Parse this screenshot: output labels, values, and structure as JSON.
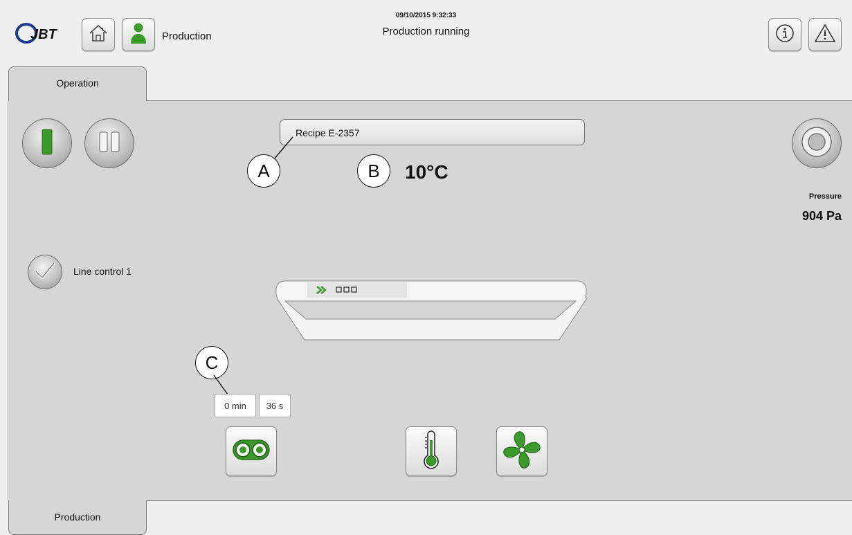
{
  "header": {
    "logo_text": "JBT",
    "user_label": "Production",
    "datetime": "09/10/2015 9:32:33",
    "status": "Production running"
  },
  "tabs": {
    "top": "Operation",
    "bottom": "Production"
  },
  "recipe": {
    "label": "Recipe E-2357"
  },
  "temperature": {
    "value": "10°C"
  },
  "pressure": {
    "label": "Pressure",
    "value": "904 Pa"
  },
  "line_control": {
    "label": "Line control 1"
  },
  "callouts": {
    "a": "A",
    "b": "B",
    "c": "C"
  },
  "timer": {
    "minutes": "0 min",
    "seconds": "36 s"
  },
  "icons": {
    "home": "home-icon",
    "user": "user-icon",
    "info": "info-icon",
    "warning": "warning-icon",
    "start": "start-icon",
    "pause": "pause-icon",
    "stop": "stop-icon",
    "check": "check-icon",
    "conveyor": "conveyor-icon",
    "thermometer": "thermometer-icon",
    "fan": "fan-icon"
  },
  "colors": {
    "accent_green": "#3a9a2a",
    "panel": "#d6d6d6",
    "background": "#efefef"
  }
}
